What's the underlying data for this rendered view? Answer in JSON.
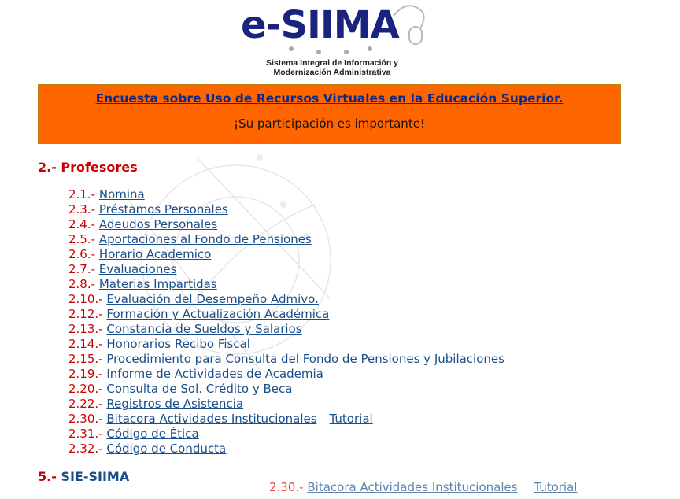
{
  "logo": {
    "title": "e-SIIMA",
    "subtitle_line1": "Sistema Integral de Información y",
    "subtitle_line2": "Modernización Administrativa"
  },
  "banner": {
    "link": "Encuesta sobre Uso de Recursos Virtuales en la Educación Superior.",
    "tagline": "¡Su participación es importante!"
  },
  "section2": {
    "title": "2.- Profesores"
  },
  "items": [
    {
      "num": "2.1.-",
      "label": "Nomina"
    },
    {
      "num": "2.3.-",
      "label": "Préstamos Personales"
    },
    {
      "num": "2.4.-",
      "label": "Adeudos Personales"
    },
    {
      "num": "2.5.-",
      "label": "Aportaciones al Fondo de Pensiones"
    },
    {
      "num": "2.6.-",
      "label": "Horario Academico"
    },
    {
      "num": "2.7.-",
      "label": "Evaluaciones"
    },
    {
      "num": "2.8.-",
      "label": "Materias Impartidas"
    },
    {
      "num": "2.10.-",
      "label": "Evaluación del Desempeño Admivo."
    },
    {
      "num": "2.12.-",
      "label": "Formación y Actualización Académica"
    },
    {
      "num": "2.13.-",
      "label": "Constancia de Sueldos y Salarios"
    },
    {
      "num": "2.14.-",
      "label": "Honorarios Recibo Fiscal"
    },
    {
      "num": "2.15.-",
      "label": "Procedimiento para Consulta del Fondo de Pensiones y Jubilaciones"
    },
    {
      "num": "2.19.-",
      "label": "Informe de Actividades de Academia"
    },
    {
      "num": "2.20.-",
      "label": "Consulta de Sol. Crédito y Beca"
    },
    {
      "num": "2.22.-",
      "label": "Registros de Asistencia"
    },
    {
      "num": "2.30.-",
      "label": "Bitacora Actividades Institucionales",
      "extra": "Tutorial"
    },
    {
      "num": "2.31.-",
      "label": "Código de Ética"
    },
    {
      "num": "2.32.-",
      "label": "Código de Conducta"
    }
  ],
  "section5": {
    "num": "5.-",
    "link": "SIE-SIIMA"
  },
  "ghost": {
    "num": "2.30.-",
    "label": "Bitacora Actividades Institucionales",
    "extra": "Tutorial"
  }
}
